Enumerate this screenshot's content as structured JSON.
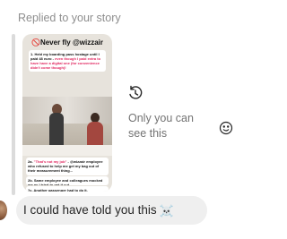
{
  "reply_context": {
    "label": "Replied to your story"
  },
  "story": {
    "headline": "🚫Never fly @wizzair",
    "box1": {
      "black_1": "1. Held my boarding pass hostage until I paid 48 euro - ",
      "red_1": "even though I paid extra to have have a digital one (for convenience didn't come though)!"
    },
    "box2": {
      "prefix": "2a. ",
      "red": "\"That's not my job\"",
      "rest": " - @wizzair employee who refused to help me get my bag out of their measurement thing..."
    },
    "box3": "2b. Same employee and colleagues mocked me as I tried to get it out",
    "box4": "2c. Another passenger had to do it."
  },
  "replay": {
    "icon": "replay-icon",
    "only_you_text": "Only you can see this"
  },
  "message": {
    "text": "I could have told you this",
    "emoji": "☠️"
  },
  "icons": {
    "react": "smiley-icon",
    "avatar": "avatar"
  }
}
